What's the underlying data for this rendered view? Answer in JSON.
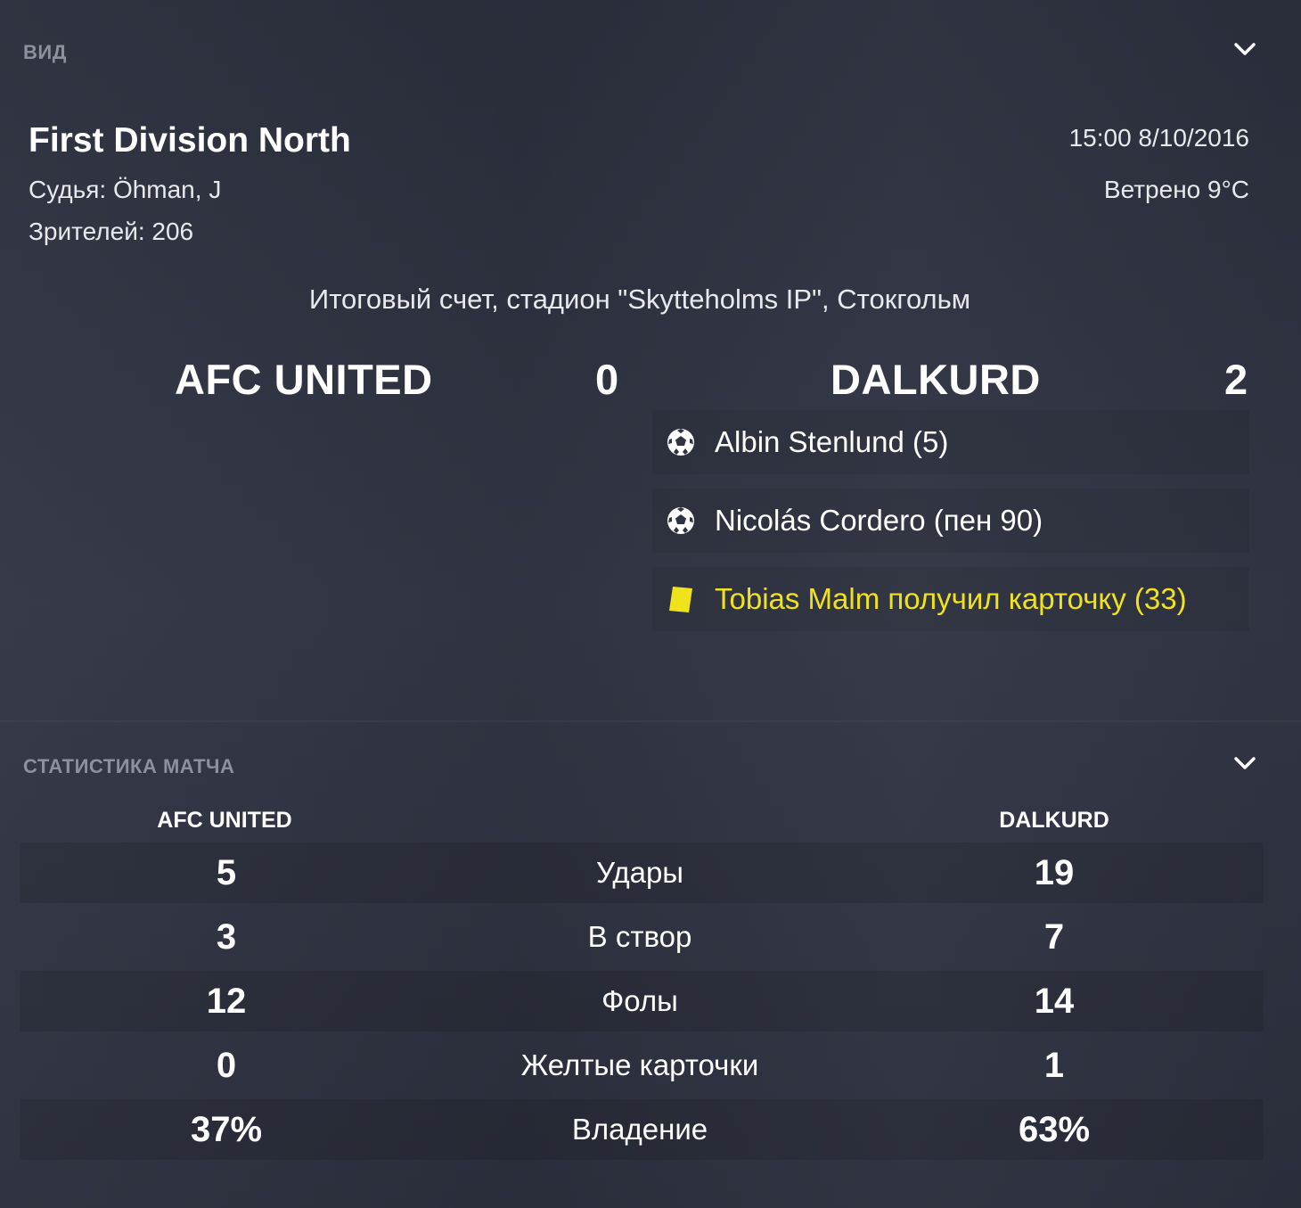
{
  "view_section": {
    "header": "ВИД"
  },
  "match": {
    "competition": "First Division North",
    "referee": "Судья: Öhman, J",
    "attendance": "Зрителей: 206",
    "datetime": "15:00 8/10/2016",
    "weather": "Ветрено 9°C",
    "venue_line": "Итоговый счет, стадион \"Skytteholms IP\", Стокгольм",
    "home_team": "AFC UNITED",
    "home_score": "0",
    "away_team": "DALKURD",
    "away_score": "2",
    "events": [
      {
        "type": "goal",
        "icon": "soccer-ball-icon",
        "text": "Albin Stenlund (5)"
      },
      {
        "type": "goal",
        "icon": "soccer-ball-icon",
        "text": "Nicolás Cordero (пен 90)"
      },
      {
        "type": "yellow-card",
        "icon": "yellow-card-icon",
        "text": "Tobias Malm получил карточку (33)"
      }
    ]
  },
  "stats_section": {
    "header": "СТАТИСТИКА МАТЧА",
    "home_team": "AFC UNITED",
    "away_team": "DALKURD",
    "rows": [
      {
        "home": "5",
        "label": "Удары",
        "away": "19"
      },
      {
        "home": "3",
        "label": "В створ",
        "away": "7"
      },
      {
        "home": "12",
        "label": "Фолы",
        "away": "14"
      },
      {
        "home": "0",
        "label": "Желтые карточки",
        "away": "1"
      },
      {
        "home": "37%",
        "label": "Владение",
        "away": "63%"
      }
    ]
  },
  "colors": {
    "background": "#2f3342",
    "header_text": "#8d919d",
    "yellow_card": "#f0e31c"
  }
}
